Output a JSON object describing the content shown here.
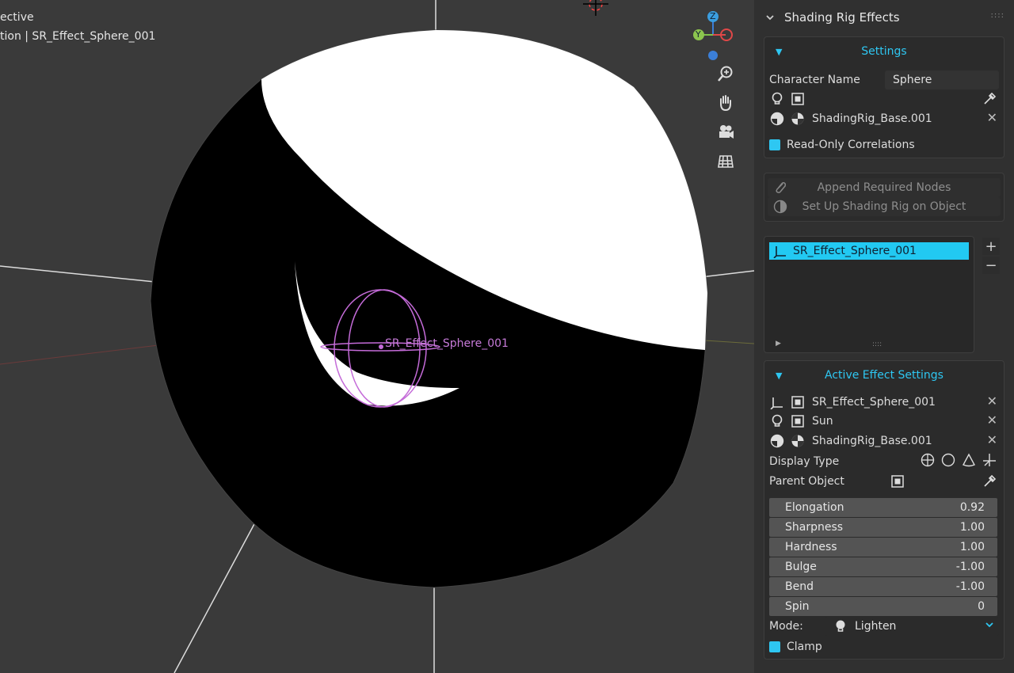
{
  "viewport": {
    "view_label": "ective",
    "collection_label": "tion | SR_Effect_Sphere_001",
    "object_label": "SR_Effect_Sphere_001",
    "gizmo": {
      "z": "Z",
      "y": "Y"
    },
    "nav_icons": [
      "zoom-icon",
      "hand-pan-icon",
      "camera-icon",
      "grid-icon"
    ]
  },
  "panel": {
    "title": "Shading Rig Effects",
    "settings": {
      "header": "Settings",
      "character_name_label": "Character Name",
      "character_name_value": "Sphere",
      "base_object": "ShadingRig_Base.001",
      "read_only_label": "Read-Only Correlations"
    },
    "actions": {
      "append_nodes": "Append Required Nodes",
      "setup_rig": "Set Up Shading Rig on Object"
    },
    "effects_list": {
      "items": [
        "SR_Effect_Sphere_001"
      ],
      "add": "+",
      "remove": "−"
    },
    "active": {
      "header": "Active Effect Settings",
      "effect_object": "SR_Effect_Sphere_001",
      "light_object": "Sun",
      "base_object": "ShadingRig_Base.001",
      "display_type_label": "Display Type",
      "parent_object_label": "Parent Object",
      "sliders": [
        {
          "label": "Elongation",
          "value": "0.92"
        },
        {
          "label": "Sharpness",
          "value": "1.00"
        },
        {
          "label": "Hardness",
          "value": "1.00"
        },
        {
          "label": "Bulge",
          "value": "-1.00"
        },
        {
          "label": "Bend",
          "value": "-1.00"
        },
        {
          "label": "Spin",
          "value": "0"
        }
      ],
      "mode_label": "Mode:",
      "mode_value": "Lighten",
      "clamp_label": "Clamp"
    }
  },
  "colors": {
    "accent": "#22c9f2",
    "selection_outline": "#c46bd8",
    "sphere_dark": "#000000",
    "sphere_light": "#ffffff"
  }
}
